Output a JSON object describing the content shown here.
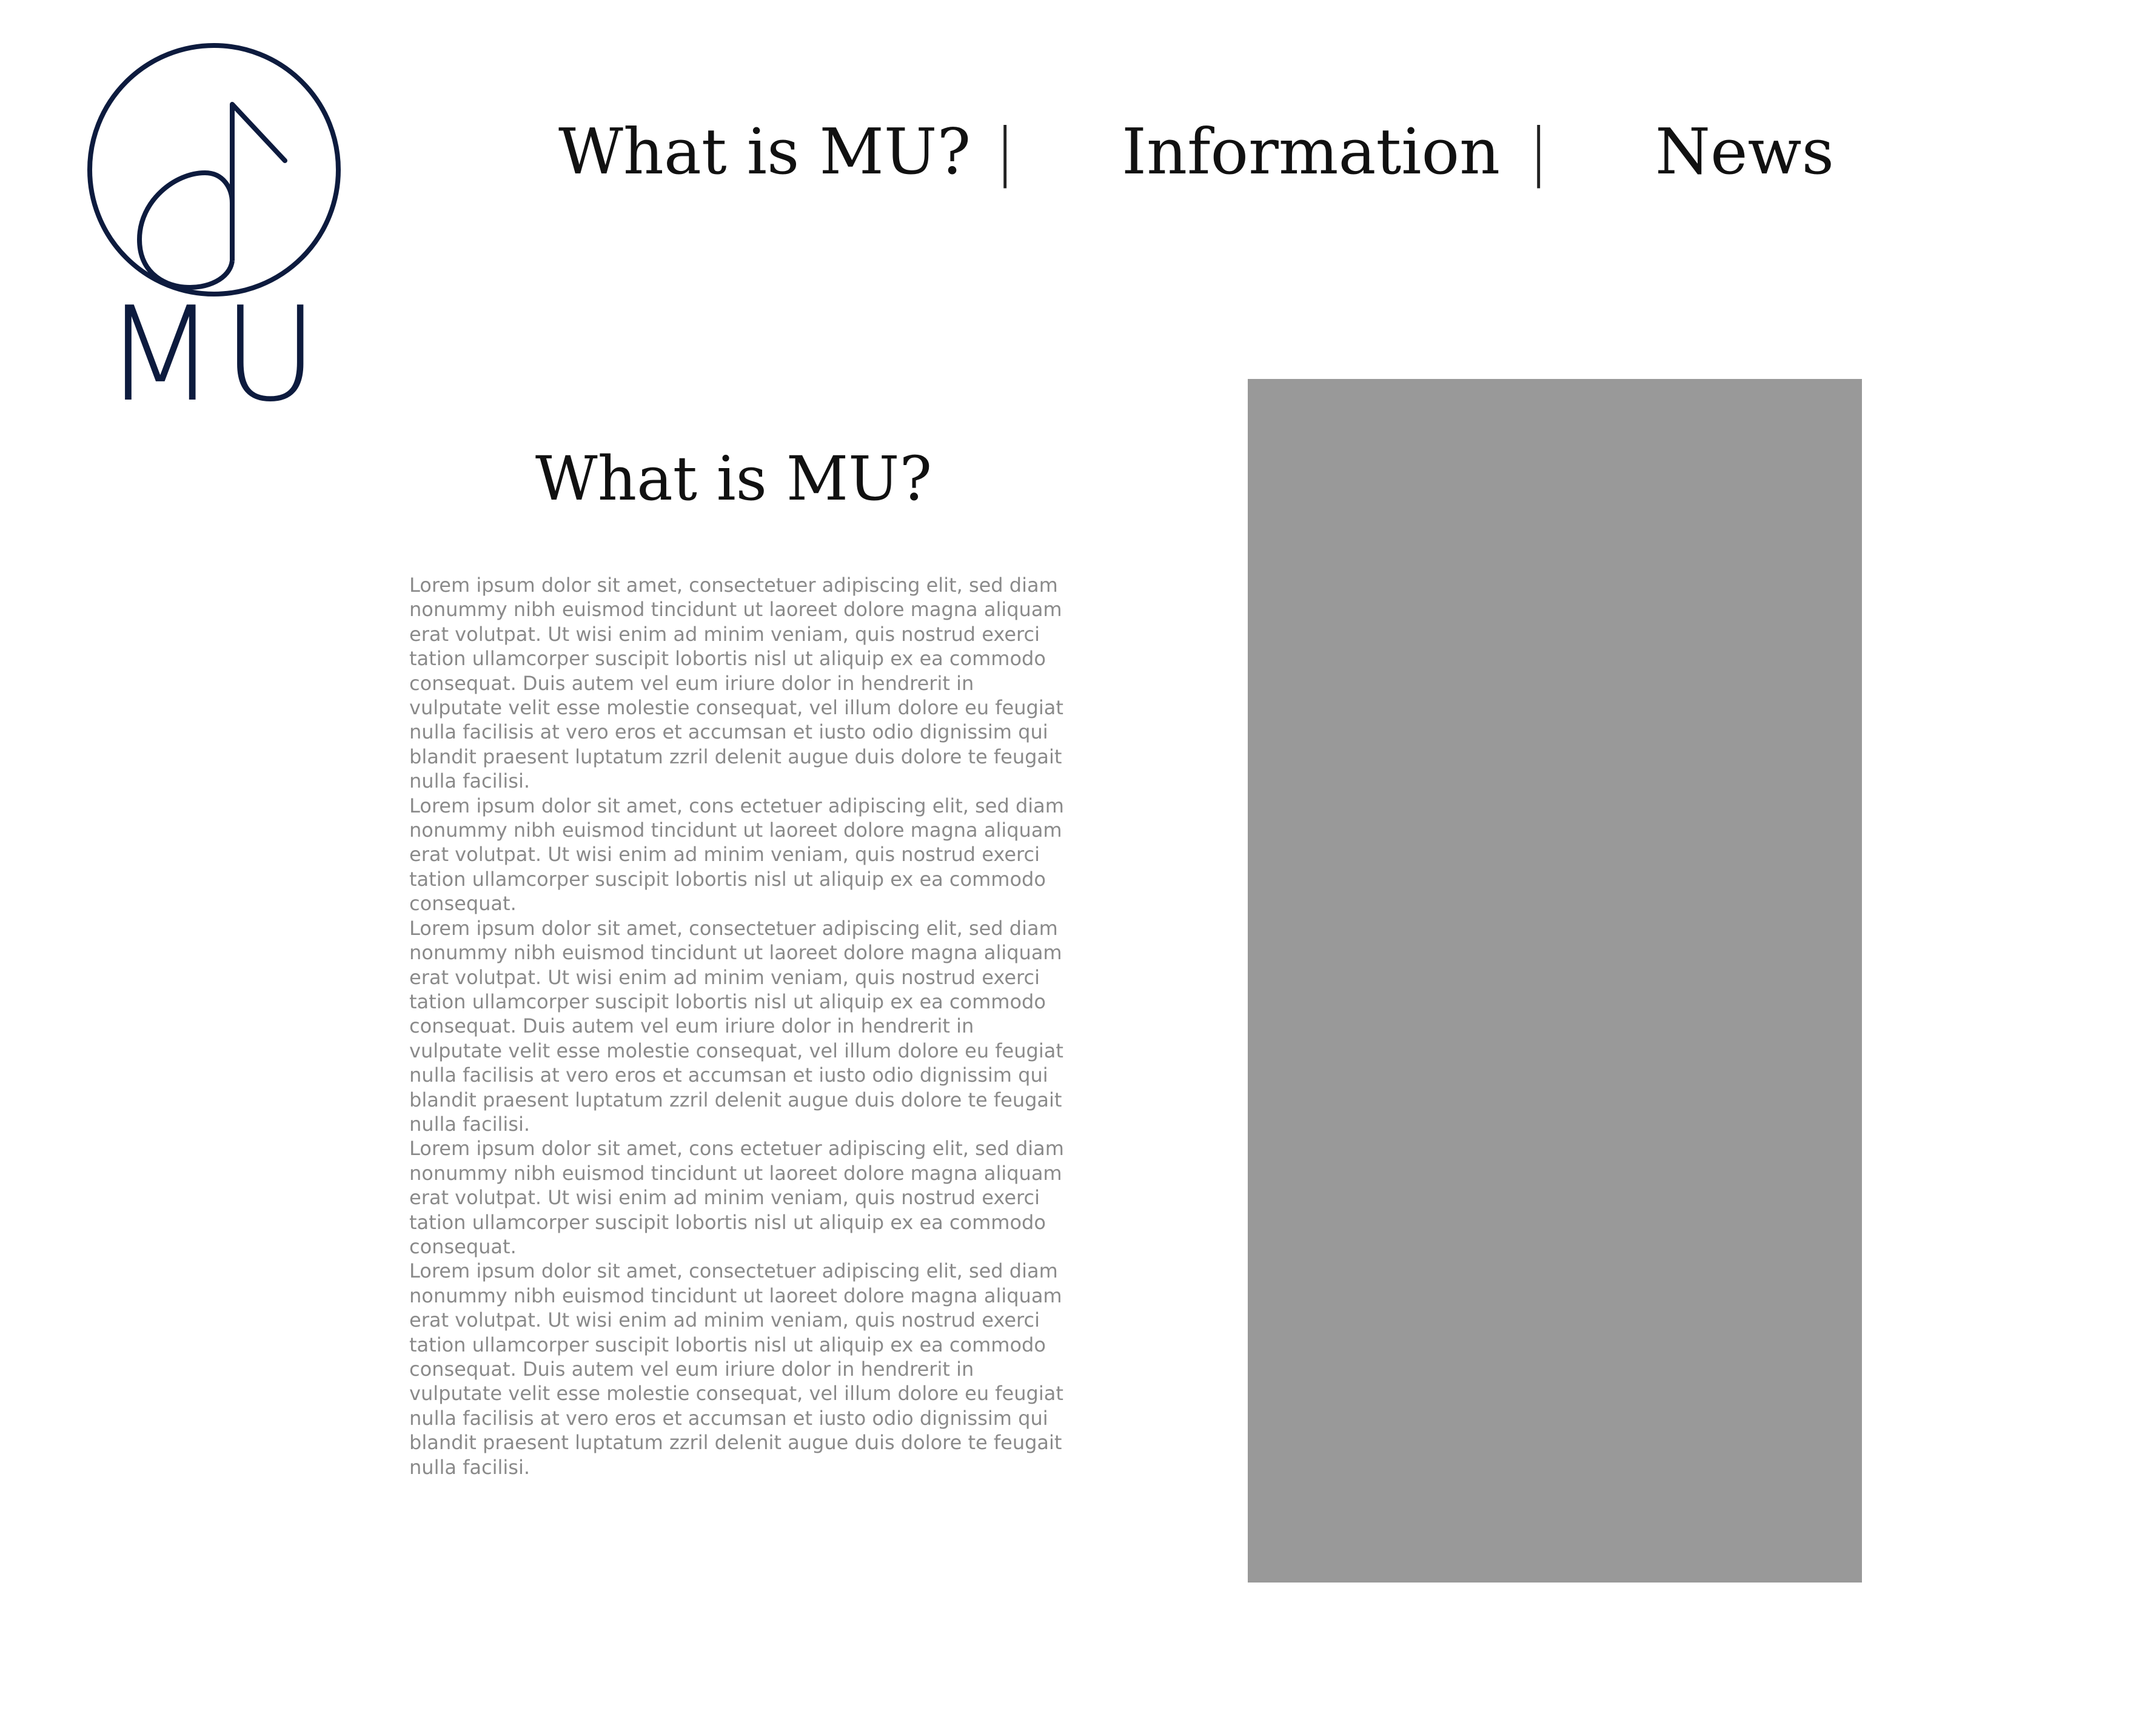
{
  "logo": {
    "text": "MU",
    "icon": "music-note-circle-icon",
    "color": "#0d1b3e"
  },
  "nav": {
    "items": [
      {
        "label": "What is MU?"
      },
      {
        "label": "Information"
      },
      {
        "label": "News"
      }
    ],
    "separator": "|"
  },
  "main": {
    "title": "What is MU?",
    "paragraphs": [
      "Lorem ipsum dolor sit amet, consectetuer adipiscing elit, sed diam nonummy nibh euismod tincidunt ut laoreet dolore magna aliquam erat volutpat. Ut wisi enim ad minim veniam, quis nostrud exerci tation ullamcorper suscipit lobortis nisl ut aliquip ex ea commodo consequat. Duis autem vel eum iriure dolor in hendrerit in vulputate velit esse molestie consequat, vel illum dolore eu feugiat nulla facilisis at vero eros et accumsan et iusto odio dignissim qui blandit praesent luptatum zzril delenit augue duis dolore te feugait nulla facilisi.",
      "Lorem ipsum dolor sit amet, cons ectetuer adipiscing elit, sed diam nonummy nibh euismod tincidunt ut laoreet dolore magna aliquam erat volutpat. Ut wisi enim ad minim veniam, quis nostrud exerci tation ullamcorper suscipit lobortis nisl ut aliquip ex ea commodo consequat.",
      "Lorem ipsum dolor sit amet, consectetuer adipiscing elit, sed diam nonummy nibh euismod tincidunt ut laoreet dolore magna aliquam erat volutpat. Ut wisi enim ad minim veniam, quis nostrud exerci tation ullamcorper suscipit lobortis nisl ut aliquip ex ea commodo consequat. Duis autem vel eum iriure dolor in hendrerit in vulputate velit esse molestie consequat, vel illum dolore eu feugiat nulla facilisis at vero eros et accumsan et iusto odio dignissim qui blandit praesent luptatum zzril delenit augue duis dolore te feugait nulla facilisi.",
      "Lorem ipsum dolor sit amet, cons ectetuer adipiscing elit, sed diam nonummy nibh euismod tincidunt ut laoreet dolore magna aliquam erat volutpat. Ut wisi enim ad minim veniam, quis nostrud exerci tation ullamcorper suscipit lobortis nisl ut aliquip ex ea commodo consequat.",
      "Lorem ipsum dolor sit amet, consectetuer adipiscing elit, sed diam nonummy nibh euismod tincidunt ut laoreet dolore magna aliquam erat volutpat. Ut wisi enim ad minim veniam, quis nostrud exerci tation ullamcorper suscipit lobortis nisl ut aliquip ex ea commodo consequat. Duis autem vel eum iriure dolor in hendrerit in vulputate velit esse molestie consequat, vel illum dolore eu feugiat nulla facilisis at vero eros et accumsan et iusto odio dignissim qui blandit praesent luptatum zzril delenit augue duis dolore te feugait nulla facilisi."
    ],
    "image_placeholder_color": "#999999"
  }
}
